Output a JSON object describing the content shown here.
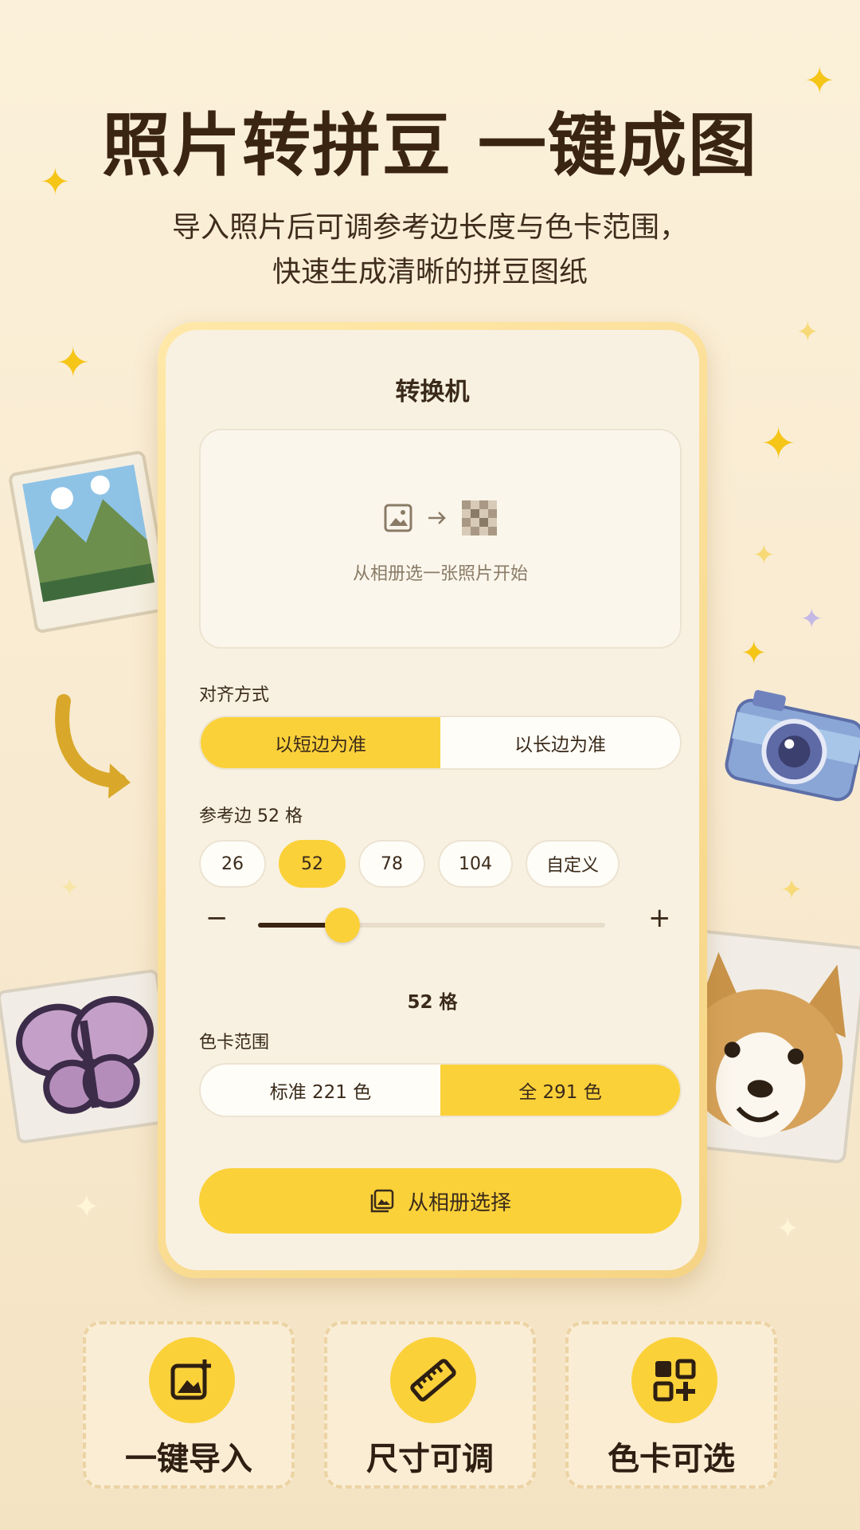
{
  "hero": {
    "title": "照片转拼豆 一键成图",
    "subtitle_line1": "导入照片后可调参考边长度与色卡范围，",
    "subtitle_line2": "快速生成清晰的拼豆图纸"
  },
  "screen": {
    "title": "转换机",
    "preview_hint": "从相册选一张照片开始",
    "align": {
      "label": "对齐方式",
      "options": [
        "以短边为准",
        "以长边为准"
      ],
      "selected": "以短边为准"
    },
    "reference": {
      "label": "参考边 52 格",
      "options": [
        "26",
        "52",
        "78",
        "104",
        "自定义"
      ],
      "selected": "52",
      "minus": "−",
      "plus": "+",
      "slider_fraction": 0.2,
      "value_text": "52 格"
    },
    "palette": {
      "label": "色卡范围",
      "options": [
        "标准 221 色",
        "全 291 色"
      ],
      "selected": "全 291 色"
    },
    "cta": "从相册选择"
  },
  "features": [
    {
      "label": "一键导入",
      "icon": "image-add-icon"
    },
    {
      "label": "尺寸可调",
      "icon": "ruler-icon"
    },
    {
      "label": "色卡可选",
      "icon": "qr-grid-icon"
    }
  ],
  "colors": {
    "accent": "#fbd13a",
    "text": "#3a2a1a",
    "background": "#fbf0d9"
  }
}
